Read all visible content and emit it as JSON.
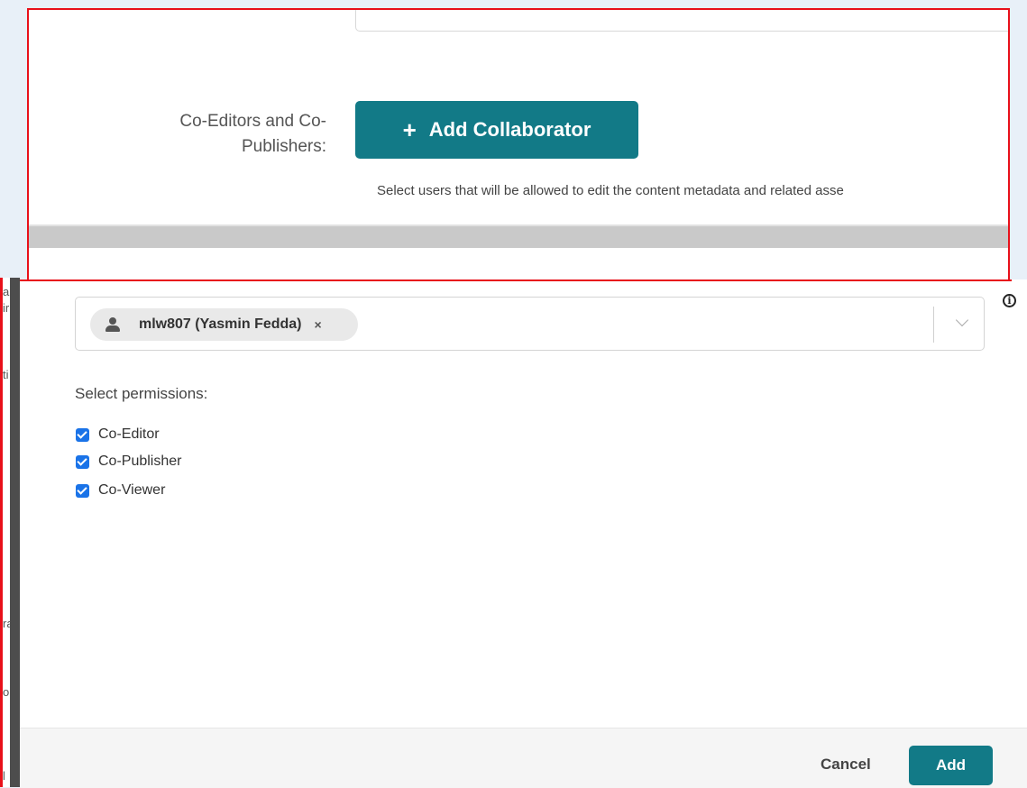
{
  "form": {
    "coeditors_label_line1": "Co-Editors and Co-",
    "coeditors_label_line2": "Publishers:",
    "add_collaborator_label": "Add Collaborator",
    "helper_text": "Select users that will be allowed to edit the content metadata and related asse"
  },
  "background_fragments": [
    "a",
    "ir",
    "ti",
    "ra",
    "ol",
    "l"
  ],
  "modal": {
    "selected_user": "mlw807 (Yasmin Fedda)",
    "remove_symbol": "×",
    "info_symbol": "i",
    "permissions_title": "Select permissions:",
    "permissions": [
      {
        "label": "Co-Editor",
        "checked": true
      },
      {
        "label": "Co-Publisher",
        "checked": true
      },
      {
        "label": "Co-Viewer",
        "checked": true
      }
    ],
    "cancel_label": "Cancel",
    "add_label": "Add"
  },
  "colors": {
    "primary": "#127a87",
    "checkbox": "#1a73e8",
    "highlight_border": "#e8101a"
  }
}
